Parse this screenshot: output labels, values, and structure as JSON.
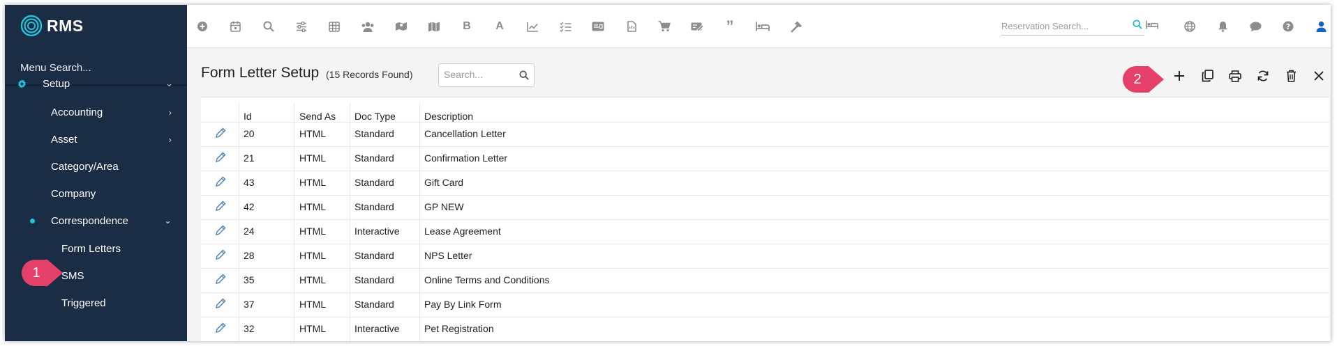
{
  "app": {
    "logo_text": "RMS"
  },
  "sidebar": {
    "menu_search_label": "Menu Search...",
    "setup": {
      "label": "Setup"
    },
    "items": [
      {
        "label": "Accounting",
        "has_children": true
      },
      {
        "label": "Asset",
        "has_children": true
      },
      {
        "label": "Category/Area",
        "has_children": false
      },
      {
        "label": "Company",
        "has_children": false
      },
      {
        "label": "Correspondence",
        "has_children": true,
        "expanded": true
      }
    ],
    "subitems": [
      {
        "label": "Form Letters",
        "selected": true
      },
      {
        "label": "SMS"
      },
      {
        "label": "Triggered"
      }
    ]
  },
  "topbar": {
    "icons": [
      "add-circle-icon",
      "calendar-icon",
      "search-icon",
      "sliders-icon",
      "grid-icon",
      "guests-icon",
      "map-icon",
      "map-fold-icon",
      "bold-b-icon",
      "letter-a-icon",
      "chart-line-icon",
      "checklist-icon",
      "id-card-icon",
      "document-icon",
      "cart-icon",
      "voucher-icon",
      "quote-icon",
      "bed-icon",
      "hammer-icon"
    ],
    "reservation_search_placeholder": "Reservation Search...",
    "right_icons": [
      "globe-icon",
      "bell-icon",
      "chat-icon",
      "help-icon",
      "user-icon"
    ]
  },
  "page": {
    "title": "Form Letter Setup",
    "record_count": "(15 Records Found)",
    "search_placeholder": "Search..."
  },
  "table": {
    "columns": [
      "Id",
      "Send As",
      "Doc Type",
      "Description"
    ],
    "rows": [
      {
        "id": "20",
        "send_as": "HTML",
        "doc_type": "Standard",
        "description": "Cancellation Letter"
      },
      {
        "id": "21",
        "send_as": "HTML",
        "doc_type": "Standard",
        "description": "Confirmation Letter"
      },
      {
        "id": "43",
        "send_as": "HTML",
        "doc_type": "Standard",
        "description": "Gift Card"
      },
      {
        "id": "42",
        "send_as": "HTML",
        "doc_type": "Standard",
        "description": "GP NEW"
      },
      {
        "id": "24",
        "send_as": "HTML",
        "doc_type": "Interactive",
        "description": "Lease Agreement"
      },
      {
        "id": "28",
        "send_as": "HTML",
        "doc_type": "Standard",
        "description": "NPS Letter"
      },
      {
        "id": "35",
        "send_as": "HTML",
        "doc_type": "Standard",
        "description": "Online Terms and Conditions"
      },
      {
        "id": "37",
        "send_as": "HTML",
        "doc_type": "Standard",
        "description": "Pay By Link Form"
      },
      {
        "id": "32",
        "send_as": "HTML",
        "doc_type": "Interactive",
        "description": "Pet Registration"
      }
    ]
  },
  "annotations": {
    "callout_1": "1",
    "callout_2": "2"
  },
  "colors": {
    "sidebar_bg": "#1a2d44",
    "accent": "#21c4d8",
    "callout": "#e5406a",
    "search_accent": "#1fb8d6",
    "user_icon": "#1565c0"
  }
}
